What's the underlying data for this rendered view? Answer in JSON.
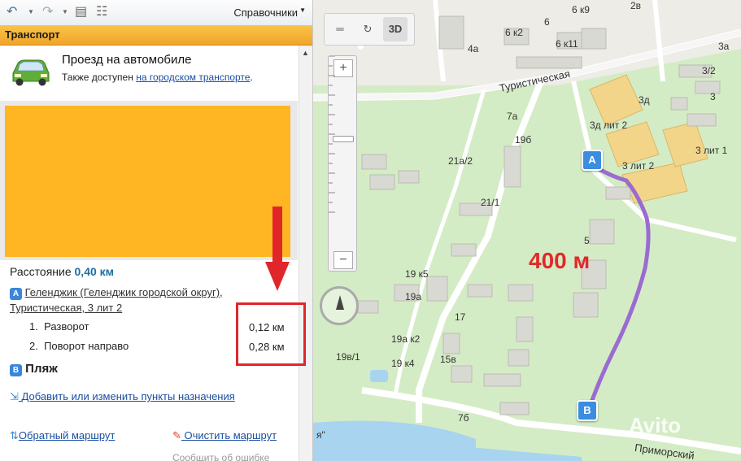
{
  "toolbar": {
    "directory_label": "Справочники"
  },
  "section": {
    "title": "Транспорт"
  },
  "route": {
    "title": "Проезд на автомобиле",
    "also_text": "Также доступен ",
    "also_link": "на городском транспорте",
    "also_end": ".",
    "distance_label": "Расстояние ",
    "distance_value": "0,40 км",
    "start_marker": "A",
    "start_address_line1": "Геленджик (Геленджик городской округ),",
    "start_address_line2": "Туристическая, 3 лит 2",
    "steps": [
      {
        "num": "1.",
        "text": "Разворот",
        "dist": "0,12 км"
      },
      {
        "num": "2.",
        "text": "Поворот направо",
        "dist": "0,28 км"
      }
    ],
    "end_marker": "B",
    "end_name": "Пляж",
    "add_points_link": "Добавить или изменить пункты назначения",
    "reverse_link": "Обратный маршрут",
    "clear_link": "Очистить маршрут",
    "report_error": "Сообщить об ошибке"
  },
  "map": {
    "btn_3d": "3D",
    "distance_annotation": "400 м",
    "pin_a": "A",
    "pin_b": "B",
    "watermark": "Avito",
    "streets": {
      "top": "Туристическая",
      "bottom": "Приморский"
    },
    "labels": [
      "6 к9",
      "2в",
      "6",
      "6 к2",
      "6 к11",
      "4а",
      "3а",
      "3/2",
      "3",
      "3д",
      "3д лит 2",
      "3 лит 1",
      "3 лит 2",
      "7а",
      "19б",
      "21а/2",
      "21/1",
      "5",
      "19 к5",
      "19а",
      "17",
      "19а к2",
      "19 к4",
      "15в",
      "19в/1",
      "7б",
      "я\""
    ]
  },
  "colors": {
    "route": "#9b6bd1",
    "accent": "#ffb622",
    "highlight": "#e0262b"
  }
}
